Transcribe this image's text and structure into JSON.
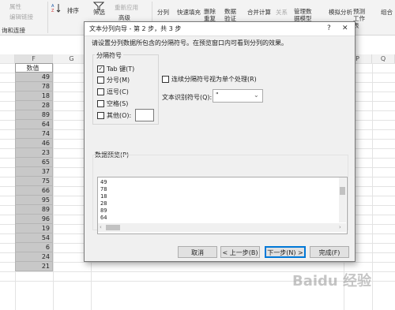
{
  "ribbon": {
    "items": [
      {
        "label": "属性"
      },
      {
        "label": "编辑链接"
      },
      {
        "label": "排序"
      },
      {
        "label": "筛选"
      },
      {
        "label": "重新应用"
      },
      {
        "label": "高级"
      },
      {
        "label": "分列"
      },
      {
        "label": "快速填充"
      },
      {
        "label": "删除重复值"
      },
      {
        "label": "数据验证"
      },
      {
        "label": "合并计算"
      },
      {
        "label": "关系"
      },
      {
        "label": "管理数据模型"
      },
      {
        "label": "模拟分析"
      },
      {
        "label": "预测工作表"
      },
      {
        "label": "组合"
      }
    ],
    "group_label": "询和连接"
  },
  "columns": [
    "F",
    "G",
    "P",
    "Q"
  ],
  "sheet": {
    "header_value": "数值",
    "values": [
      "49",
      "78",
      "18",
      "28",
      "89",
      "64",
      "74",
      "46",
      "23",
      "65",
      "37",
      "75",
      "66",
      "95",
      "89",
      "96",
      "19",
      "54",
      "6",
      "24",
      "21"
    ]
  },
  "dialog": {
    "title": "文本分列向导 - 第 2 步，共 3 步",
    "help_button": "?",
    "close_button": "✕",
    "instruction": "请设置分列数据所包含的分隔符号。在预览窗口内可看到分列的效果。",
    "delimiters_group": "分隔符号",
    "delimiters": [
      {
        "label": "Tab 键(T)",
        "checked": true
      },
      {
        "label": "分号(M)",
        "checked": false
      },
      {
        "label": "逗号(C)",
        "checked": false
      },
      {
        "label": "空格(S)",
        "checked": false
      },
      {
        "label": "其他(O):",
        "checked": false
      }
    ],
    "consecutive_label": "连续分隔符号视为单个处理(R)",
    "qualifier_label": "文本识别符号(Q):",
    "qualifier_value": "\"",
    "preview_label": "数据预览(P)",
    "preview_lines": [
      "49",
      "78",
      "18",
      "28",
      "89",
      "64"
    ],
    "buttons": {
      "cancel": "取消",
      "back": "< 上一步(B)",
      "next": "下一步(N) >",
      "finish": "完成(F)"
    }
  },
  "watermark": "Baidu 经验"
}
